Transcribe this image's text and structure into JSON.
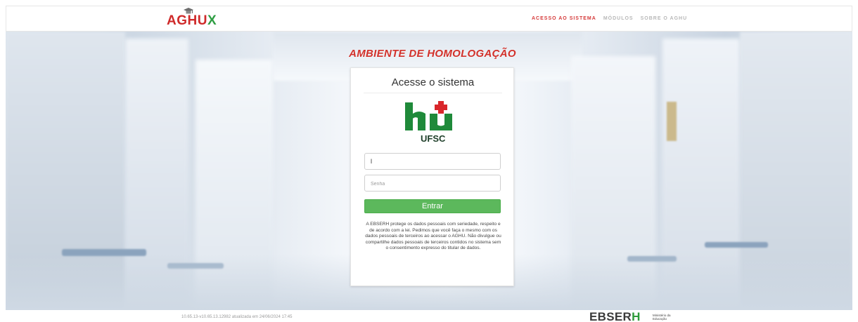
{
  "header": {
    "logo_text": "AGHU",
    "logo_x": "X",
    "nav": [
      {
        "label": "ACESSO AO SISTEMA",
        "active": true
      },
      {
        "label": "MÓDULOS",
        "active": false
      },
      {
        "label": "SOBRE O AGHU",
        "active": false
      }
    ]
  },
  "banner": {
    "text": "AMBIENTE DE HOMOLOGAÇÃO"
  },
  "login": {
    "title": "Acesse o sistema",
    "logo_text": "hu",
    "logo_subtext": "UFSC",
    "user_value": "l",
    "password_placeholder": "Senha",
    "submit_label": "Entrar",
    "privacy_text": "A EBSERH protege os dados pessoais com seriedade, respeito e de acordo com a lei. Pedimos que você faça o mesmo com os dados pessoais de terceiros ao acessar o AGHU. Não divulgue ou compartilhe dados pessoais de terceiros contidos no sistema sem o consentimento expresso do titular de dados."
  },
  "footer": {
    "version_text": "10.65.13-v10.65.13.12982 atualizada em 24/06/2024 17:45",
    "ebserh_prefix": "EBSER",
    "ebserh_h": "H",
    "ministerio": "Ministério da Educação"
  },
  "colors": {
    "brand_red": "#d2312b",
    "brand_green": "#2f9e44",
    "button_green": "#5cb85c"
  },
  "icons": [
    "graduation-cap-icon",
    "hospital-cross-icon"
  ]
}
